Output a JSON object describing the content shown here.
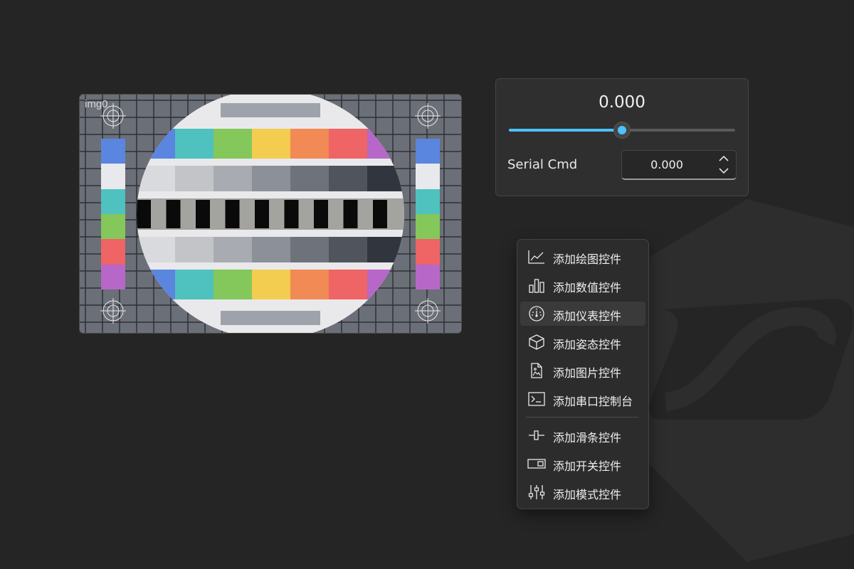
{
  "image_widget": {
    "label": "img0"
  },
  "serial_panel": {
    "slider": {
      "value_text": "0.000",
      "fill_fraction": 0.5,
      "accent": "#4cc2ff"
    },
    "cmd_label": "Serial Cmd",
    "spinbox": {
      "value": "0.000"
    }
  },
  "context_menu": {
    "items": [
      {
        "label": "添加绘图控件",
        "icon": "line-chart-icon"
      },
      {
        "label": "添加数值控件",
        "icon": "bar-chart-icon"
      },
      {
        "label": "添加仪表控件",
        "icon": "gauge-icon"
      },
      {
        "label": "添加姿态控件",
        "icon": "cube-icon"
      },
      {
        "label": "添加图片控件",
        "icon": "image-file-icon"
      },
      {
        "label": "添加串口控制台",
        "icon": "terminal-icon"
      },
      {
        "label": "添加滑条控件",
        "icon": "slider-icon"
      },
      {
        "label": "添加开关控件",
        "icon": "switch-icon"
      },
      {
        "label": "添加模式控件",
        "icon": "mode-tuner-icon"
      }
    ]
  }
}
